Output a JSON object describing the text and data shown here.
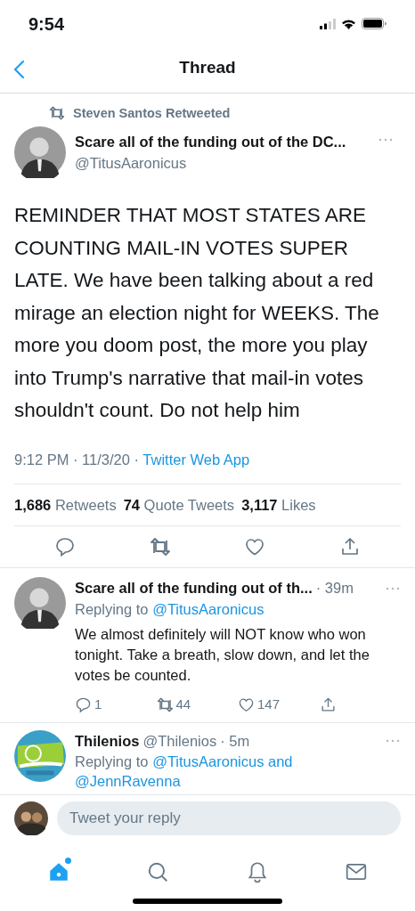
{
  "status_bar": {
    "time": "9:54"
  },
  "header": {
    "title": "Thread"
  },
  "main_tweet": {
    "retweeted_by": "Steven Santos Retweeted",
    "name": "Scare all of the funding out of the DC...",
    "handle": "@TitusAaronicus",
    "text": "REMINDER THAT MOST STATES ARE COUNTING MAIL-IN VOTES SUPER LATE. We have been talking about a red mirage an election night for WEEKS. The more you doom post, the more you play into Trump's narrative that mail-in votes shouldn't count. Do not help him",
    "timestamp": "9:12 PM · 11/3/20 · ",
    "source": "Twitter Web App",
    "stats": [
      {
        "count": "1,686",
        "label": "Retweets"
      },
      {
        "count": "74",
        "label": "Quote Tweets"
      },
      {
        "count": "3,117",
        "label": "Likes"
      }
    ]
  },
  "replies": [
    {
      "kind": "person",
      "name": "Scare all of the funding out of th...",
      "time": "· 39m",
      "replying_label": "Replying to ",
      "mentions": [
        "@TitusAaronicus"
      ],
      "text": "We almost definitely will NOT know who won tonight. Take a breath, slow down, and let the votes be counted.",
      "actions": [
        {
          "kind": "reply",
          "count": "1"
        },
        {
          "kind": "retweet",
          "count": "44"
        },
        {
          "kind": "like",
          "count": "147"
        },
        {
          "kind": "share"
        }
      ]
    },
    {
      "kind": "picture",
      "name": "Thilenios",
      "handle": "@Thilenios",
      "time": "· 5m",
      "replying_label": "Replying to ",
      "mentions": [
        "@TitusAaronicus",
        "@JennRavenna"
      ],
      "conjunction": "and"
    }
  ],
  "reply_bar": {
    "placeholder": "Tweet your reply"
  },
  "tab_bar": [
    {
      "kind": "home",
      "selected": true,
      "badge": true
    },
    {
      "kind": "search",
      "selected": false
    },
    {
      "kind": "notifications",
      "selected": false
    },
    {
      "kind": "messages",
      "selected": false
    }
  ]
}
